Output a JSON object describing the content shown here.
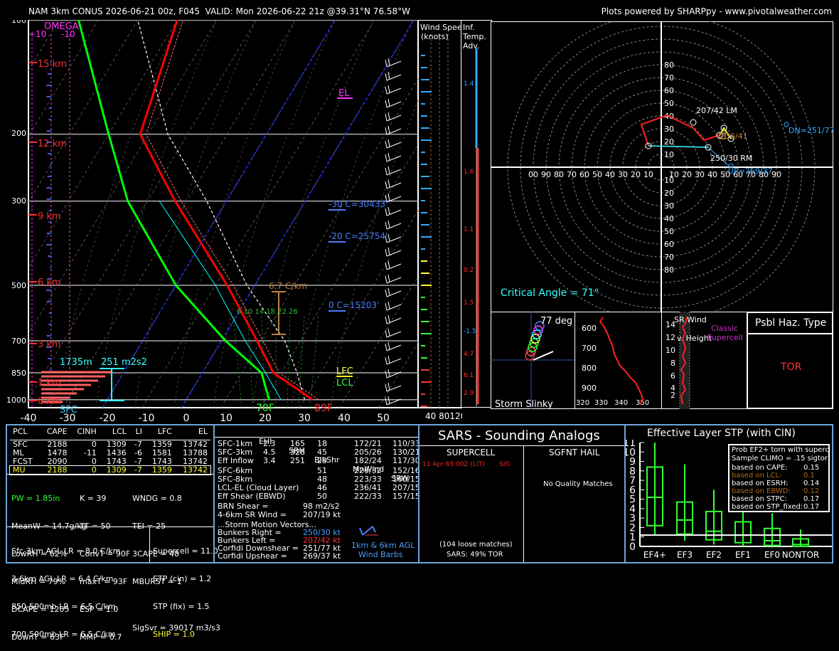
{
  "header": {
    "left": "NAM 3km CONUS 2026-06-21 00z, F045  VALID: Mon 2026-06-22 21z @39.31°N 76.58°W",
    "right": "Plots powered by SHARPpy - www.pivotalweather.com"
  },
  "skewt": {
    "omega_label": "OMEGA",
    "omega_plus": "+10",
    "omega_minus": "-10",
    "pressure_levels": [
      "100",
      "200",
      "300",
      "500",
      "700",
      "850",
      "1000"
    ],
    "temp_ticks": [
      "-40",
      "-30",
      "-20",
      "-10",
      "0",
      "10",
      "20",
      "30",
      "40",
      "50"
    ],
    "height_labels": [
      "15 km",
      "12 km",
      "9 km",
      "6 km",
      "3 km",
      "1 km",
      "0 km"
    ],
    "el_label": "EL",
    "lfc_label": "LFC",
    "lcl_label": "LCL",
    "lapse_label": "6.7 C/km",
    "isotherm_m30": "-30 C=30433'",
    "isotherm_m20": "-20 C=25754'",
    "isotherm_0": "0 C=15203'",
    "mixing_ratios": "6  10 14  18  22 26",
    "eff_inflow_base": "1735m",
    "eff_inflow_srh": "251 m2s2",
    "sfc_label": "SFC",
    "sfc_dewpoint": "70F",
    "sfc_temp": "89F"
  },
  "wind_panel": {
    "title1": "Wind Speed",
    "title2": "(knots)",
    "ticks": "40 80120"
  },
  "tadv_panel": {
    "title1": "Inf.",
    "title2": "Temp.",
    "title3": "Adv.",
    "values": [
      "1.4",
      "1.6",
      "1.1",
      "0.2",
      "1.5",
      "-1.5",
      "4.7",
      "6.1",
      "2.9"
    ]
  },
  "hodograph": {
    "rings": [
      "80",
      "70",
      "60",
      "50",
      "40",
      "30",
      "20",
      "10"
    ],
    "axis_labels": [
      "00",
      "90",
      "80",
      "70",
      "60",
      "50",
      "40",
      "30",
      "20",
      "10",
      "10",
      "20",
      "30",
      "40",
      "50",
      "60",
      "70",
      "80",
      "90"
    ],
    "lm": "207/42 LM",
    "rm": "250/30 RM",
    "dn": "DN=251/77",
    "up": "UP=269/37",
    "storm_motion": "236/41",
    "critical_angle": "Critical Angle = 71°",
    "point_labels": [
      "6",
      "4",
      "2",
      "0",
      "1",
      "3"
    ]
  },
  "slinky": {
    "angle": "77 deg",
    "label": "Storm Slinky"
  },
  "theta_panel": {
    "y_ticks": [
      "600",
      "700",
      "800",
      "900"
    ],
    "x_ticks": [
      "320",
      "330",
      "340",
      "350"
    ]
  },
  "sr_wind": {
    "title1": "SR Wind",
    "title2": "v. Height",
    "classic1": "Classic",
    "classic2": "Supercell",
    "y_ticks": [
      "14",
      "12",
      "10",
      "8",
      "6",
      "4",
      "2"
    ]
  },
  "hazard": {
    "title": "Psbl Haz. Type",
    "value": "TOR"
  },
  "parcels": {
    "headers": [
      "PCL",
      "CAPE",
      "CINH",
      "LCL",
      "LI",
      "LFC",
      "EL"
    ],
    "rows": [
      [
        "SFC",
        "2188",
        "0",
        "1309",
        "-7",
        "1359",
        "13742"
      ],
      [
        "ML",
        "1478",
        "-11",
        "1436",
        "-6",
        "1581",
        "13788"
      ],
      [
        "FCST",
        "2090",
        "0",
        "1743",
        "-7",
        "1743",
        "13742"
      ],
      [
        "MU",
        "2188",
        "0",
        "1309",
        "-7",
        "1359",
        "13742"
      ]
    ]
  },
  "indices": {
    "col1": [
      "PW = 1.85in",
      "MeanW = 14.7g/kg",
      "LowRH = 62%",
      "MidRH = 79%",
      "DCAPE = 1205",
      "DownT = 63F"
    ],
    "col2": [
      "K = 39",
      "TT = 50",
      "ConvT = 90F",
      "maxT = 93F",
      "ESP = 1.0",
      "MMP = 0.7"
    ],
    "col3": [
      "WNDG = 0.8",
      "TEI = 25",
      "3CAPE = 48",
      "MBURST = 1",
      "",
      "SigSvr = 39017 m3/s3"
    ],
    "lapse": [
      "Sfc-3km AGL LR = 8.0 C/km",
      "3-6km AGL LR = 6.4 C/km",
      "850-500mb LR = 6.5 C/km",
      "700-500mb LR = 6.5 C/km"
    ],
    "composite": [
      "Supercell = 11.0",
      "STP (cin) = 1.2",
      "STP (fix) = 1.5",
      "SHIP = 1.0"
    ]
  },
  "kinematics": {
    "headers": [
      "EHI",
      "SRH",
      "BlkShr",
      "MnWind",
      "SRW"
    ],
    "rows1": [
      [
        "SFC-1km",
        "2.3",
        "165",
        "18",
        "172/21",
        "110/33"
      ],
      [
        "SFC-3km",
        "4.5",
        "328",
        "45",
        "205/26",
        "130/21"
      ],
      [
        "Eff Inflow",
        "3.4",
        "251",
        "29",
        "182/24",
        "117/30"
      ]
    ],
    "rows2": [
      [
        "SFC-6km",
        "",
        "",
        "51",
        "220/32",
        "152/16"
      ],
      [
        "SFC-8km",
        "",
        "",
        "48",
        "223/33",
        "160/15"
      ],
      [
        "LCL-EL (Cloud Layer)",
        "",
        "",
        "46",
        "236/41",
        "207/15"
      ],
      [
        "Eff Shear (EBWD)",
        "",
        "",
        "50",
        "222/33",
        "157/15"
      ]
    ],
    "brn_label": "BRN Shear =",
    "brn_value": "98 m2/s2",
    "sr46_label": "4-6km SR Wind =",
    "sr46_value": "207/19 kt",
    "motion_title": "...Storm Motion Vectors...",
    "motions": [
      [
        "Bunkers Right =",
        "250/30 kt"
      ],
      [
        "Bunkers Left =",
        "207/42 kt"
      ],
      [
        "Corfidi Downshear =",
        "251/77 kt"
      ],
      [
        "Corfidi Upshear =",
        "269/37 kt"
      ]
    ],
    "barb_label1": "1km & 6km AGL",
    "barb_label2": "Wind Barbs"
  },
  "sars": {
    "title": "SARS - Sounding Analogs",
    "supercell": "SUPERCELL",
    "hail": "SGFNT HAIL",
    "match_date": "11 Apr 65 00Z (LIT)",
    "match_type": "SIG",
    "no_match": "No Quality Matches",
    "loose": "(104 loose matches)",
    "tor_pct": "SARS: 49% TOR"
  },
  "stp": {
    "title": "Effective Layer STP (with CIN)",
    "y_ticks": [
      "11",
      "10",
      "9",
      "8",
      "7",
      "6",
      "5",
      "4",
      "3",
      "2",
      "1",
      "0"
    ],
    "categories": [
      "EF4+",
      "EF3",
      "EF2",
      "EF1",
      "EF0",
      "NONTOR"
    ],
    "prob_title": "Prob EF2+ torn with superce",
    "climo": "Sample CLIMO = .15 sigtor",
    "rows": [
      [
        "based on CAPE:",
        "0.15"
      ],
      [
        "based on LCL:",
        "0.1"
      ],
      [
        "based on ESRH:",
        "0.14"
      ],
      [
        "based on EBWD:",
        "0.12"
      ],
      [
        "based on STPC:",
        "0.17"
      ],
      [
        "based on STP_fixed:",
        "0.17"
      ]
    ]
  },
  "chart_data": [
    {
      "type": "line",
      "title": "Skew-T Log-P",
      "pressure_levels_mb": [
        1000,
        850,
        700,
        500,
        300,
        200,
        100
      ],
      "series": [
        {
          "name": "Temperature",
          "x_p_mb": [
            1000,
            850,
            700,
            500,
            300,
            200,
            100
          ],
          "values_c": [
            32,
            18,
            9,
            -7,
            -33,
            -52,
            -60
          ]
        },
        {
          "name": "Dewpoint",
          "x_p_mb": [
            1000,
            850,
            700,
            500,
            300,
            200,
            100
          ],
          "values_c": [
            21,
            15,
            1,
            -20,
            -45,
            -60,
            -85
          ]
        }
      ],
      "xlim": [
        -40,
        50
      ],
      "ylim": [
        1050,
        100
      ],
      "sfc_temp_f": 89,
      "sfc_dewpoint_f": 70,
      "colors": {
        "temperature": "#ff0000",
        "dewpoint": "#00ff00",
        "virtual": "#ff7777",
        "parcel": "#ffffff",
        "wetbulb": "#00ffff"
      }
    },
    {
      "type": "box",
      "title": "Effective Layer STP (with CIN)",
      "categories": [
        "EF4+",
        "EF3",
        "EF2",
        "EF1",
        "EF0",
        "NONTOR"
      ],
      "whisker_low": [
        1.2,
        0.6,
        0.2,
        0.0,
        0.0,
        0.0
      ],
      "q1": [
        2.2,
        1.3,
        0.7,
        0.4,
        0.1,
        0.0
      ],
      "median": [
        5.2,
        2.8,
        1.6,
        1.2,
        0.6,
        0.2
      ],
      "q3": [
        8.4,
        4.7,
        3.7,
        2.6,
        1.9,
        0.8
      ],
      "whisker_high": [
        11.0,
        8.7,
        6.0,
        4.5,
        3.5,
        1.8
      ],
      "ylim": [
        0,
        11
      ],
      "current_value": 1.2
    }
  ]
}
